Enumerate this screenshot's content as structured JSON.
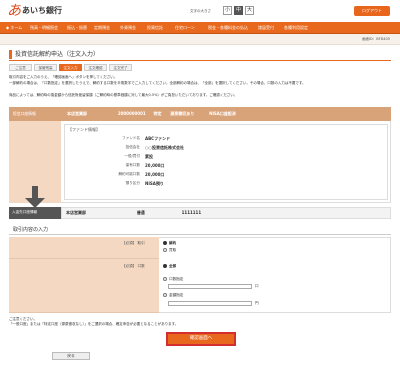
{
  "header": {
    "logo_mark": "あ",
    "logo_text": "あいち銀行",
    "fontsize_label": "文字の大きさ",
    "font_small": "小",
    "font_medium": "中",
    "font_large": "大",
    "logout_label": "ログアウト"
  },
  "nav": {
    "items": [
      "ホーム",
      "残高・明細照会",
      "振込・振替",
      "定期預金",
      "外貨預金",
      "投資信託",
      "住宅ローン",
      "税金・各種料金の払込",
      "諸届受付",
      "各種利用設定"
    ]
  },
  "screen_id": "画面ID：BFD405",
  "title": "投資信託解約申込（注文入力）",
  "steps": [
    "ご注意",
    "保管残高",
    "注文入力",
    "注文確認",
    "注文完了"
  ],
  "intro": [
    "取引内容をご入力のうえ、「確認画面へ」ボタンを押してください。",
    "一部解約の場合は、「口数指定」を選択したうえで、解約する口数を半角数字でご入力してください。全部解約の場合は、「全部」を選択してください。その場合、口数の入力は不要です。",
    "商品によっては、解約時の換金額から信託財産留保額（ご解約時の基準価額に対して最大0.5%）がご負担いただいております。ご確認ください。"
  ],
  "section1": {
    "left_label": "投信口座情報",
    "account": {
      "branch": "本店営業部",
      "number": "2000000001",
      "type": "特定",
      "status": "源泉徴収あり",
      "nisa": "NISA口座設済"
    },
    "fund_heading": "【ファンド情報】",
    "fund": [
      {
        "k": "ファンド名",
        "v": "ABCファンド"
      },
      {
        "k": "投信会社",
        "v": "○○投資信託株式会社"
      },
      {
        "k": "一般/買付",
        "v": "累投"
      },
      {
        "k": "保有口数",
        "v": "20,000口"
      },
      {
        "k": "解約可能口数",
        "v": "20,000口"
      },
      {
        "k": "預り区分",
        "v": "NISA預り"
      }
    ]
  },
  "deposit": {
    "label": "入金先口座情報",
    "branch": "本店営業部",
    "type": "普通",
    "number": "1111111"
  },
  "section2": {
    "title": "取引内容の入力",
    "required": "【必須】",
    "row1_label": "取引",
    "opt_cancel": "解約",
    "opt_buy": "買取",
    "row2_label": "口数",
    "opt_all": "全部",
    "opt_units": "口数指定",
    "unit_suffix": "口",
    "opt_amount": "金額指定",
    "amount_suffix": "円"
  },
  "notes": [
    "ご注意ください。",
    "「一般口座」または「特定口座（源泉徴収なし）」をご選択の場合、確定申告が必要となることがあります。"
  ],
  "confirm_label": "確認画面へ",
  "back_label": "戻る",
  "colors": {
    "accent": "#e8681d",
    "highlight_border": "#d32f2f"
  }
}
